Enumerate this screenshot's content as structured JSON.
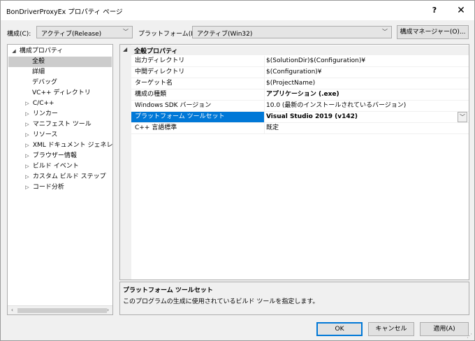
{
  "window": {
    "title": "BonDriverProxyEx プロパティ ページ",
    "help_label": "?",
    "close_label": "✕"
  },
  "toolbar": {
    "config_label": "構成(C):",
    "config_value": "アクティブ(Release)",
    "platform_label": "プラットフォーム(P):",
    "platform_value": "アクティブ(Win32)",
    "config_manager_label": "構成マネージャー(O)..."
  },
  "tree": {
    "items": [
      {
        "label": "構成プロパティ",
        "toggle": "◢"
      },
      {
        "label": "全般",
        "toggle": ""
      },
      {
        "label": "詳細",
        "toggle": ""
      },
      {
        "label": "デバッグ",
        "toggle": ""
      },
      {
        "label": "VC++ ディレクトリ",
        "toggle": ""
      },
      {
        "label": "C/C++",
        "toggle": "▷"
      },
      {
        "label": "リンカー",
        "toggle": "▷"
      },
      {
        "label": "マニフェスト ツール",
        "toggle": "▷"
      },
      {
        "label": "リソース",
        "toggle": "▷"
      },
      {
        "label": "XML ドキュメント ジェネレーター",
        "toggle": "▷"
      },
      {
        "label": "ブラウザー情報",
        "toggle": "▷"
      },
      {
        "label": "ビルド イベント",
        "toggle": "▷"
      },
      {
        "label": "カスタム ビルド ステップ",
        "toggle": "▷"
      },
      {
        "label": "コード分析",
        "toggle": "▷"
      }
    ]
  },
  "grid": {
    "category_label": "全般プロパティ",
    "category_toggle": "◢",
    "rows": [
      {
        "name": "出力ディレクトリ",
        "value": "$(SolutionDir)$(Configuration)¥"
      },
      {
        "name": "中間ディレクトリ",
        "value": "$(Configuration)¥"
      },
      {
        "name": "ターゲット名",
        "value": "$(ProjectName)"
      },
      {
        "name": "構成の種類",
        "value": "アプリケーション (.exe)"
      },
      {
        "name": "Windows SDK バージョン",
        "value": "10.0 (最新のインストールされているバージョン)"
      },
      {
        "name": "プラットフォーム ツールセット",
        "value": "Visual Studio 2019 (v142)"
      },
      {
        "name": "C++ 言語標準",
        "value": "既定"
      }
    ]
  },
  "description": {
    "title": "プラットフォーム ツールセット",
    "text": "このプログラムの生成に使用されているビルド ツールを指定します。"
  },
  "buttons": {
    "ok": "OK",
    "cancel": "キャンセル",
    "apply": "適用(A)"
  },
  "icons": {
    "dropdown": "﹀",
    "scroll_left": "‹",
    "scroll_right": "›"
  },
  "colors": {
    "selection": "#0078d7",
    "tree_selection": "#cccccc"
  }
}
